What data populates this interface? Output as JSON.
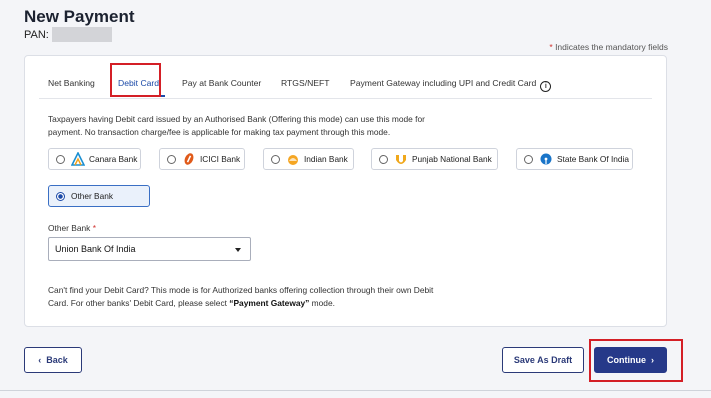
{
  "page": {
    "title": "New Payment",
    "pan_label": "PAN:",
    "mandatory_note": "Indicates the mandatory fields",
    "mandatory_star": "*"
  },
  "tabs": [
    {
      "label": "Net Banking"
    },
    {
      "label": "Debit Card",
      "active": true
    },
    {
      "label": "Pay at Bank Counter"
    },
    {
      "label": "RTGS/NEFT"
    },
    {
      "label": "Payment Gateway including UPI and Credit Card"
    }
  ],
  "info_icon_glyph": "i",
  "description": "Taxpayers having Debit card issued by an Authorised Bank (Offering this mode) can use this mode for payment. No transaction charge/fee is applicable for making tax payment through this mode.",
  "banks": [
    {
      "label": "Canara Bank",
      "icon": "canara-bank-logo-icon"
    },
    {
      "label": "ICICI Bank",
      "icon": "icici-bank-logo-icon"
    },
    {
      "label": "Indian Bank",
      "icon": "indian-bank-logo-icon"
    },
    {
      "label": "Punjab National Bank",
      "icon": "pnb-logo-icon"
    },
    {
      "label": "State Bank Of India",
      "icon": "sbi-logo-icon"
    },
    {
      "label": "Other Bank",
      "selected": true
    }
  ],
  "other_bank": {
    "label": "Other Bank",
    "required_star": "*",
    "selected_value": "Union Bank Of India"
  },
  "note": {
    "text_before": "Can't find your Debit Card? This mode is for Authorized banks offering collection through their own Debit Card. For other banks' Debit Card, please select ",
    "emphasis": "“Payment Gateway”",
    "text_after": " mode."
  },
  "buttons": {
    "back": "Back",
    "back_icon": "‹",
    "save_draft": "Save As Draft",
    "continue": "Continue",
    "continue_icon": "›"
  },
  "colors": {
    "primary": "#263989",
    "active_tab": "#1b4aa8",
    "highlight": "#d41f26",
    "required": "#d0312d"
  }
}
